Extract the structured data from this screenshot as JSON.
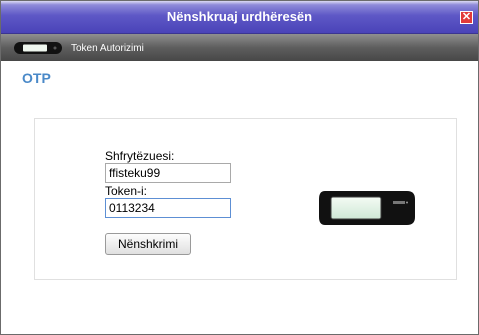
{
  "window": {
    "title": "Nënshkruaj urdhëresën",
    "close_glyph": "✕"
  },
  "tokenbar": {
    "label": "Token Autorizimi",
    "icon": "token-device-icon"
  },
  "otp": {
    "heading": "OTP"
  },
  "form": {
    "username_label": "Shfrytëzuesi:",
    "username_value": "ffisteku99",
    "token_label": "Token-i:",
    "token_value": "0113234",
    "submit_label": "Nënshkrimi"
  },
  "device": {
    "icon": "otp-token-device-icon"
  },
  "colors": {
    "title_bar": "#4a43b8",
    "otp_heading": "#4a89c8",
    "close_button": "#e23a3a"
  }
}
